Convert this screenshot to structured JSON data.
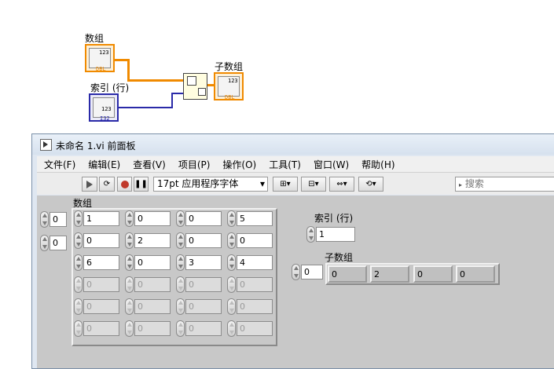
{
  "diagram": {
    "array_label": "数组",
    "index_label": "索引 (行)",
    "subarray_label": "子数组",
    "array_tag": "DBL",
    "array_type": "123",
    "index_tag": "I32",
    "index_type": "123",
    "subarray_tag": "DBL",
    "subarray_type": "123"
  },
  "window": {
    "title": "未命名 1.vi 前面板",
    "menu": [
      "文件(F)",
      "编辑(E)",
      "查看(V)",
      "项目(P)",
      "操作(O)",
      "工具(T)",
      "窗口(W)",
      "帮助(H)"
    ],
    "font_select": "17pt 应用程序字体",
    "search_placeholder": "搜索"
  },
  "front_panel": {
    "array_label": "数组",
    "array_index_row": "0",
    "array_index_col": "0",
    "array_rows": [
      [
        "1",
        "0",
        "0",
        "5"
      ],
      [
        "0",
        "2",
        "0",
        "0"
      ],
      [
        "6",
        "0",
        "3",
        "4"
      ],
      [
        "0",
        "0",
        "0",
        "0"
      ],
      [
        "0",
        "0",
        "0",
        "0"
      ],
      [
        "0",
        "0",
        "0",
        "0"
      ]
    ],
    "active_rows": 3,
    "index_label": "索引 (行)",
    "index_value": "1",
    "subarray_label": "子数组",
    "subarray_index": "0",
    "subarray_values": [
      "0",
      "2",
      "0",
      "0"
    ]
  },
  "colors": {
    "wire_array": "#f08a00",
    "wire_index": "#2a2aa8",
    "panel_bg": "#c8c8c8"
  }
}
